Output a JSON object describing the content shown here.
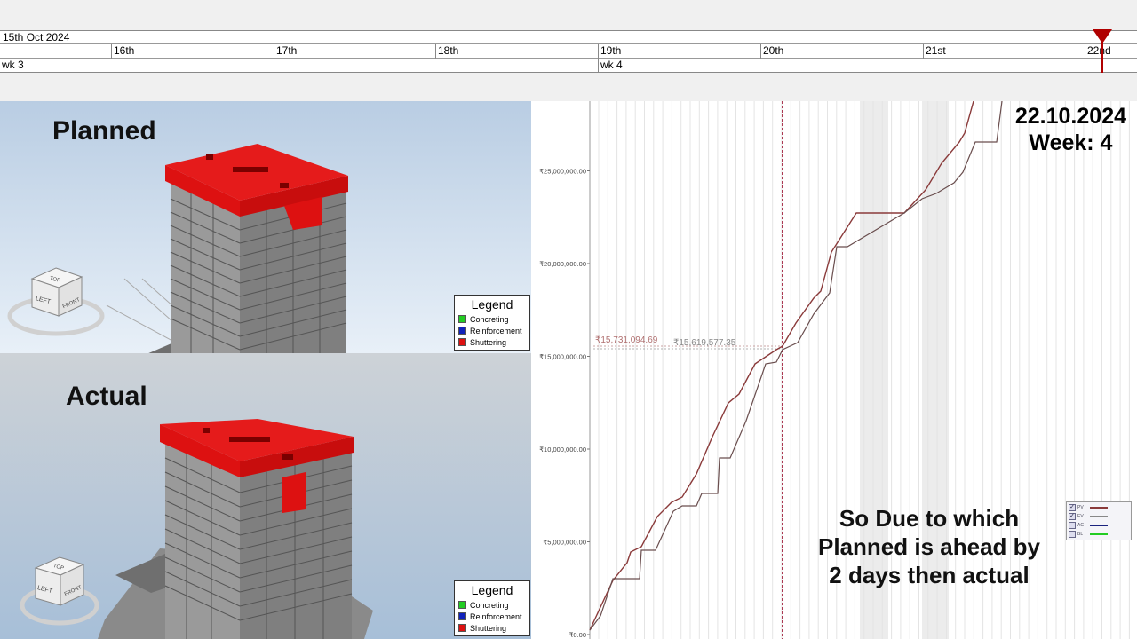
{
  "timeline": {
    "date_label": "15th Oct 2024",
    "days": [
      "16th",
      "17th",
      "18th",
      "19th",
      "20th",
      "21st",
      "22nd"
    ],
    "weeks": [
      "wk 3",
      "wk 4"
    ]
  },
  "planned_panel": {
    "title": "Planned",
    "viewcube": {
      "top": "TOP",
      "left": "LEFT",
      "front": "FRONT"
    }
  },
  "actual_panel": {
    "title": "Actual",
    "viewcube": {
      "top": "TOP",
      "left": "LEFT",
      "front": "FRONT"
    }
  },
  "legend": {
    "title": "Legend",
    "items": [
      {
        "label": "Concreting",
        "color": "#22cc22"
      },
      {
        "label": "Reinforcement",
        "color": "#1122bb"
      },
      {
        "label": "Shuttering",
        "color": "#dd1111"
      }
    ]
  },
  "overlay": {
    "date": "22.10.2024",
    "week": "Week: 4",
    "note_lines": [
      "So Due to which",
      "Planned is ahead by",
      "2 days then actual"
    ]
  },
  "chart_data": {
    "type": "line",
    "y_ticks": [
      "₹0.00",
      "₹5,000,000.00",
      "₹10,000,000.00",
      "₹15,000,000.00",
      "₹20,000,000.00",
      "₹25,000,000.00"
    ],
    "ylim": [
      0,
      29000000
    ],
    "annotations": [
      "₹15,731,094.69",
      "₹15,619,577.35"
    ],
    "series": [
      {
        "name": "PV",
        "color": "#8a3a3a"
      },
      {
        "name": "EV",
        "color": "#6a4e4e"
      }
    ],
    "legend": [
      {
        "label": "PV",
        "checked": true,
        "color": "#8a3a3a"
      },
      {
        "label": "EV",
        "checked": true,
        "color": "#888888"
      },
      {
        "label": "AC",
        "checked": false,
        "color": "#1a237e"
      },
      {
        "label": "BL",
        "checked": false,
        "color": "#22cc22"
      }
    ]
  },
  "colors": {
    "marker": "#b00000",
    "building_top": "#dd1111",
    "pv_line": "#8a3a3a"
  }
}
